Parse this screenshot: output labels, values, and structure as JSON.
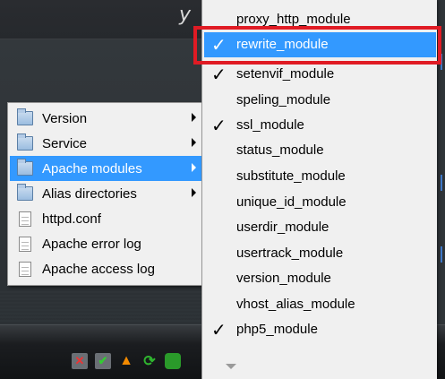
{
  "window": {
    "title_fragment": "y"
  },
  "submenu": {
    "items": [
      {
        "label": "Version",
        "icon": "folder-icon",
        "has_submenu": true
      },
      {
        "label": "Service",
        "icon": "folder-icon",
        "has_submenu": true
      },
      {
        "label": "Apache modules",
        "icon": "folder-icon",
        "has_submenu": true,
        "selected": true
      },
      {
        "label": "Alias directories",
        "icon": "folder-icon",
        "has_submenu": true
      },
      {
        "label": "httpd.conf",
        "icon": "document-icon"
      },
      {
        "label": "Apache error log",
        "icon": "document-icon"
      },
      {
        "label": "Apache access log",
        "icon": "document-icon"
      }
    ]
  },
  "modules": {
    "items": [
      {
        "label": "proxy_http_module",
        "checked": false
      },
      {
        "label": "rewrite_module",
        "checked": true,
        "selected": true
      },
      {
        "label": "setenvif_module",
        "checked": true
      },
      {
        "label": "speling_module",
        "checked": false
      },
      {
        "label": "ssl_module",
        "checked": true
      },
      {
        "label": "status_module",
        "checked": false
      },
      {
        "label": "substitute_module",
        "checked": false
      },
      {
        "label": "unique_id_module",
        "checked": false
      },
      {
        "label": "userdir_module",
        "checked": false
      },
      {
        "label": "usertrack_module",
        "checked": false
      },
      {
        "label": "version_module",
        "checked": false
      },
      {
        "label": "vhost_alias_module",
        "checked": false
      },
      {
        "label": "php5_module",
        "checked": true
      }
    ],
    "check_mark": "✓"
  },
  "taskbar": {
    "tray_icons": [
      "network-icon",
      "shield-icon",
      "vlc-cone-icon",
      "refresh-icon",
      "wamp-icon"
    ]
  },
  "colors": {
    "selection": "#3399ff",
    "annotation_box": "#e01b24",
    "menu_background": "#f0f0f0"
  }
}
